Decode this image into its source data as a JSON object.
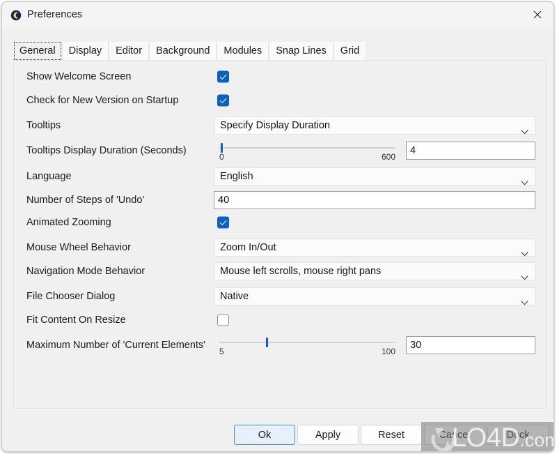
{
  "window": {
    "title": "Preferences",
    "icon": "app-icon",
    "close_icon": "close-icon"
  },
  "tabs": [
    {
      "label": "General",
      "active": true
    },
    {
      "label": "Display",
      "active": false
    },
    {
      "label": "Editor",
      "active": false
    },
    {
      "label": "Background",
      "active": false
    },
    {
      "label": "Modules",
      "active": false
    },
    {
      "label": "Snap Lines",
      "active": false
    },
    {
      "label": "Grid",
      "active": false
    }
  ],
  "settings": [
    {
      "label": "Show Welcome Screen",
      "type": "checkbox",
      "checked": true
    },
    {
      "label": "Check for New Version on Startup",
      "type": "checkbox",
      "checked": true
    },
    {
      "label": "Tooltips",
      "type": "combo",
      "value": "Specify Display Duration"
    },
    {
      "label": "Tooltips Display Duration (Seconds)",
      "type": "slider",
      "value": "4",
      "min": "0",
      "max": "600"
    },
    {
      "label": "Language",
      "type": "combo",
      "value": "English"
    },
    {
      "label": "Number of Steps of 'Undo'",
      "type": "textbox",
      "value": "40"
    },
    {
      "label": "Animated Zooming",
      "type": "checkbox",
      "checked": true
    },
    {
      "label": "Mouse Wheel Behavior",
      "type": "combo",
      "value": "Zoom In/Out"
    },
    {
      "label": "Navigation Mode Behavior",
      "type": "combo",
      "value": "Mouse left scrolls, mouse right pans"
    },
    {
      "label": "File Chooser Dialog",
      "type": "combo",
      "value": "Native"
    },
    {
      "label": "Fit Content On Resize",
      "type": "checkbox",
      "checked": false
    },
    {
      "label": "Maximum Number of 'Current Elements'",
      "type": "slider",
      "value": "30",
      "min": "5",
      "max": "100"
    }
  ],
  "buttons": [
    {
      "label": "Ok",
      "primary": true
    },
    {
      "label": "Apply",
      "primary": false
    },
    {
      "label": "Reset",
      "primary": false
    },
    {
      "label": "Cancel",
      "primary": false
    },
    {
      "label": "Dock",
      "primary": false
    }
  ],
  "watermark": {
    "name": "LO4D",
    "domain": ".com"
  },
  "colors": {
    "accent": "#0a61c2",
    "window_bg": "#f0f0f0",
    "field_bg": "#ffffff",
    "primary_button_bg": "#e6f1fb",
    "primary_button_border": "#3f8fd4"
  }
}
